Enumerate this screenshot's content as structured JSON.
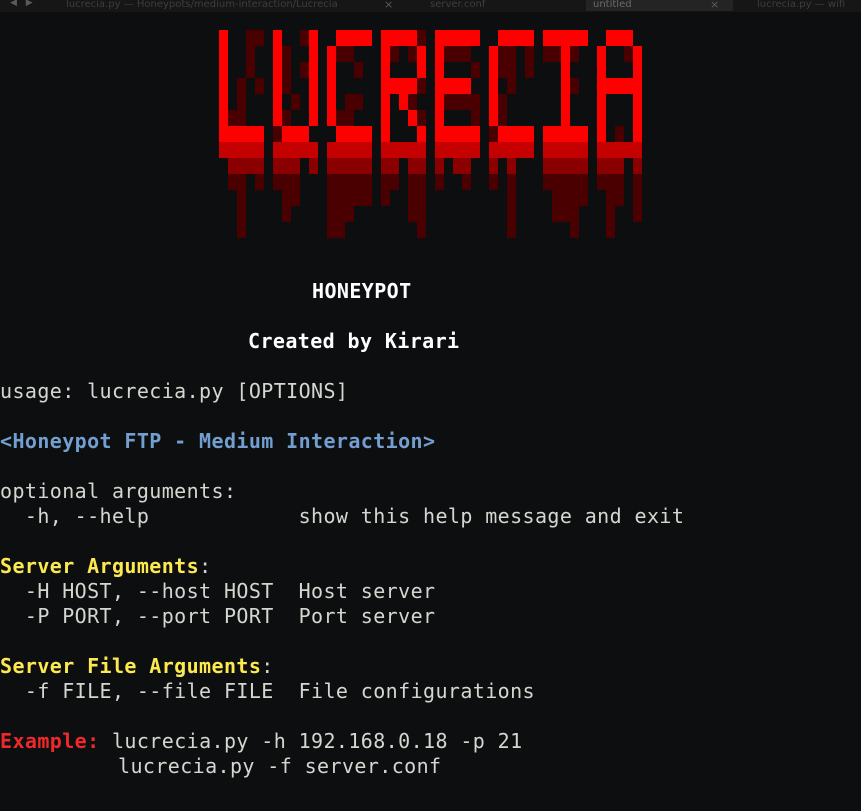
{
  "window": {
    "tabs": [
      {
        "label": "lucrecia.py — Honeypots/medium-interaction/Lucrecia",
        "active": false
      },
      {
        "label": "server.conf",
        "active": false
      },
      {
        "label": "untitled",
        "active": true
      },
      {
        "label": "lucrecia.py — wifi",
        "active": false
      }
    ],
    "close_glyph": "×",
    "nav_arrows": "◀ ▶"
  },
  "banner": {
    "text": "LUCRECIA",
    "colors": [
      "#ff0000",
      "#c40000",
      "#8a0000",
      "#4a0000"
    ]
  },
  "terminal": {
    "subtitle": "HONEYPOT",
    "credit": "Created by Kirari",
    "usage": "usage: lucrecia.py [OPTIONS]",
    "description": "<Honeypot FTP - Medium Interaction>",
    "optional_header": "optional arguments:",
    "help_flag": "  -h, --help            ",
    "help_desc": "show this help message and exit",
    "server_header": "Server Arguments",
    "host_flag": "  -H HOST, --host HOST  ",
    "host_desc": "Host server",
    "port_flag": "  -P PORT, --port PORT  ",
    "port_desc": "Port server",
    "file_header": "Server File Arguments",
    "file_flag": "  -f FILE, --file FILE  ",
    "file_desc": "File configurations",
    "example_label": "Example:",
    "example_1": "lucrecia.py -h 192.168.0.18 -p 21",
    "example_2": "lucrecia.py -f server.conf"
  }
}
